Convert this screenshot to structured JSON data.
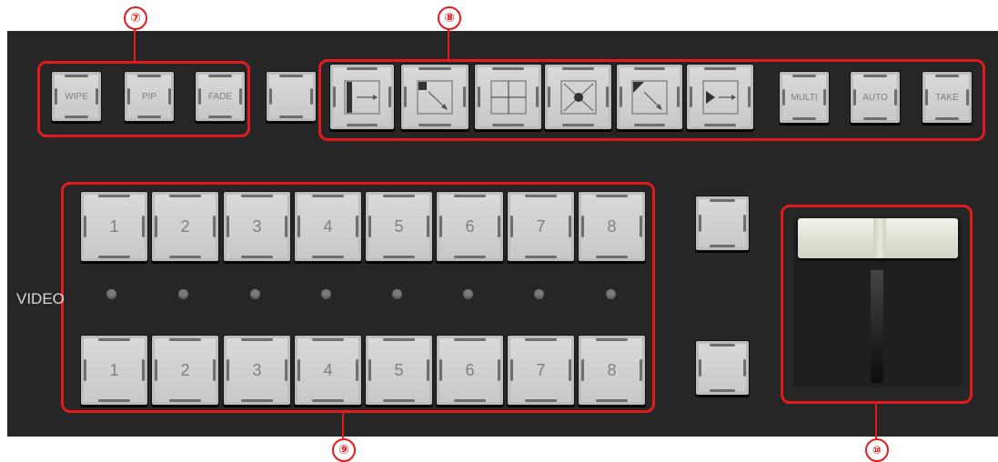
{
  "callouts": [
    "⑦",
    "⑧",
    "⑨",
    "⑩"
  ],
  "transition_buttons": [
    {
      "label": "WIPE"
    },
    {
      "label": "PIP"
    },
    {
      "label": "FADE"
    }
  ],
  "wipe_patterns": [
    {
      "icon": "wipe-left-bar-pattern-icon"
    },
    {
      "icon": "wipe-corner-diagonal-pattern-icon"
    },
    {
      "icon": "wipe-quad-split-pattern-icon"
    },
    {
      "icon": "wipe-center-expand-pattern-icon"
    },
    {
      "icon": "wipe-triangle-corner-pattern-icon"
    },
    {
      "icon": "wipe-play-arrow-pattern-icon"
    }
  ],
  "control_buttons": [
    {
      "label": "MULTI"
    },
    {
      "label": "AUTO"
    },
    {
      "label": "TAKE"
    }
  ],
  "video_label": "VIDEO",
  "program_row": [
    "1",
    "2",
    "3",
    "4",
    "5",
    "6",
    "7",
    "8"
  ],
  "preview_row": [
    "1",
    "2",
    "3",
    "4",
    "5",
    "6",
    "7",
    "8"
  ],
  "colors": {
    "panel": "#262626",
    "annotation": "#e21c1c",
    "key": "#d4d4d4"
  }
}
